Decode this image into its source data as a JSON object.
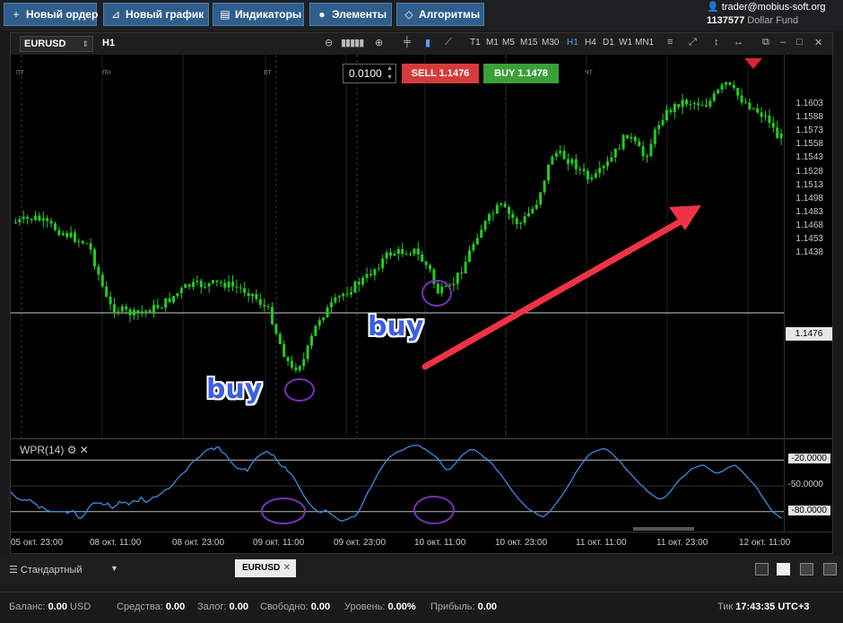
{
  "toolbar": {
    "new_order": "Новый ордер",
    "new_chart": "Новый график",
    "indicators": "Индикаторы",
    "elements": "Элементы",
    "algorithms": "Алгоритмы"
  },
  "account": {
    "user": "trader@mobius-soft.org",
    "number": "1137577",
    "fund": "Dollar Fund"
  },
  "chart": {
    "symbol": "EURUSD",
    "timeframe": "H1",
    "timeframes": [
      "T1",
      "M1",
      "M5",
      "M15",
      "M30",
      "H1",
      "H4",
      "D1",
      "W1",
      "MN1"
    ],
    "active_tf": "H1",
    "day_labels": [
      "пт",
      "пн",
      "вт",
      "ср",
      "чт"
    ],
    "order": {
      "quantity": "0.0100",
      "sell_label": "SELL",
      "sell_price": "1.1476",
      "buy_label": "BUY",
      "buy_price": "1.1478"
    },
    "current_price": "1.1476",
    "price_labels": [
      "1.1603",
      "1.1588",
      "1.1573",
      "1.1558",
      "1.1543",
      "1.1528",
      "1.1513",
      "1.1498",
      "1.1483",
      "1.1468",
      "1.1453",
      "1.1438"
    ],
    "annotations": [
      "buy",
      "buy"
    ],
    "x_labels": [
      "05 окт. 23:00",
      "08 окт. 11:00",
      "08 окт. 23:00",
      "09 окт. 11:00",
      "09 окт. 23:00",
      "10 окт. 11:00",
      "10 окт. 23:00",
      "11 окт. 11:00",
      "11 окт. 23:00",
      "12 окт. 11:00"
    ],
    "colors": {
      "bull": "#22cc22",
      "bear": "#22cc22",
      "arrow": "#ee3344",
      "circle": "#7a2fb8",
      "wpr": "#3a8de0"
    }
  },
  "indicator": {
    "name": "WPR(14)",
    "levels": [
      "-20.0000",
      "-50.0000",
      "-80.0000"
    ]
  },
  "chart_data": {
    "type": "line",
    "title": "WPR(14)",
    "ylim": [
      -100,
      0
    ],
    "levels": [
      -20,
      -80
    ],
    "values": [
      -57,
      -60,
      -63,
      -65,
      -66,
      -67,
      -66,
      -67,
      -66,
      -68,
      -70,
      -72,
      -76,
      -74,
      -76,
      -78,
      -79,
      -80,
      -80,
      -80,
      -80,
      -80,
      -80,
      -80,
      -82,
      -80,
      -79,
      -80,
      -85,
      -88,
      -87,
      -84,
      -80,
      -75,
      -72,
      -70,
      -70,
      -70,
      -70,
      -72,
      -72,
      -70,
      -74,
      -76,
      -74,
      -72,
      -68,
      -70,
      -69,
      -70,
      -72,
      -69,
      -67,
      -68,
      -68,
      -63,
      -66,
      -69,
      -68,
      -66,
      -63,
      -63,
      -62,
      -60,
      -58,
      -55,
      -54,
      -53,
      -50,
      -47,
      -43,
      -40,
      -37,
      -35,
      -33,
      -28,
      -25,
      -22,
      -20,
      -18,
      -16,
      -13,
      -10,
      -8,
      -7,
      -6,
      -8,
      -5,
      -5,
      -10,
      -12,
      -14,
      -18,
      -22,
      -25,
      -28,
      -30,
      -30,
      -31,
      -30,
      -33,
      -28,
      -24,
      -20,
      -17,
      -15,
      -13,
      -12,
      -10,
      -11,
      -14,
      -14,
      -18,
      -22,
      -26,
      -28,
      -28,
      -33,
      -35,
      -38,
      -42,
      -47,
      -52,
      -57,
      -62,
      -66,
      -70,
      -73,
      -76,
      -78,
      -80,
      -81,
      -80,
      -78,
      -80,
      -82,
      -84,
      -86,
      -88,
      -90,
      -91,
      -90,
      -89,
      -88,
      -86,
      -86,
      -84,
      -80,
      -75,
      -69,
      -63,
      -57,
      -53,
      -48,
      -42,
      -37,
      -32,
      -28,
      -24,
      -20,
      -17,
      -15,
      -13,
      -11,
      -10,
      -9,
      -8,
      -6,
      -5,
      -4,
      -3,
      -3,
      -3,
      -4,
      -6,
      -7,
      -9,
      -11,
      -13,
      -15,
      -17,
      -20,
      -24,
      -28,
      -31,
      -31,
      -30,
      -27,
      -24,
      -20,
      -17,
      -14,
      -12,
      -10,
      -8,
      -8,
      -8,
      -10,
      -12,
      -14,
      -17,
      -18,
      -21,
      -23,
      -26,
      -30,
      -33,
      -36,
      -40,
      -44,
      -48,
      -52,
      -56,
      -59,
      -63,
      -66,
      -69,
      -72,
      -75,
      -77,
      -79,
      -80,
      -82,
      -84,
      -85,
      -86,
      -84,
      -82,
      -79,
      -76,
      -72,
      -69,
      -65,
      -61,
      -57,
      -53,
      -48,
      -44,
      -39,
      -34,
      -30,
      -26,
      -22,
      -19,
      -15,
      -13,
      -11,
      -10,
      -9,
      -8,
      -7,
      -7,
      -8,
      -10,
      -12,
      -15,
      -18,
      -20,
      -23,
      -27,
      -30,
      -33,
      -36,
      -39,
      -42,
      -45,
      -48,
      -50,
      -53,
      -56,
      -58,
      -60,
      -62,
      -64,
      -65,
      -65,
      -64,
      -62,
      -59,
      -56,
      -52,
      -48,
      -45,
      -42,
      -40,
      -38,
      -35,
      -32,
      -30,
      -29,
      -28,
      -27,
      -26,
      -26,
      -28,
      -30,
      -32,
      -34,
      -35,
      -35,
      -34,
      -33,
      -31,
      -29,
      -28,
      -27,
      -26,
      -28,
      -30,
      -33,
      -36,
      -39,
      -42,
      -45,
      -48,
      -51,
      -55,
      -60,
      -64,
      -68,
      -72,
      -76,
      -80,
      -82,
      -84,
      -86,
      -88
    ]
  }
}
